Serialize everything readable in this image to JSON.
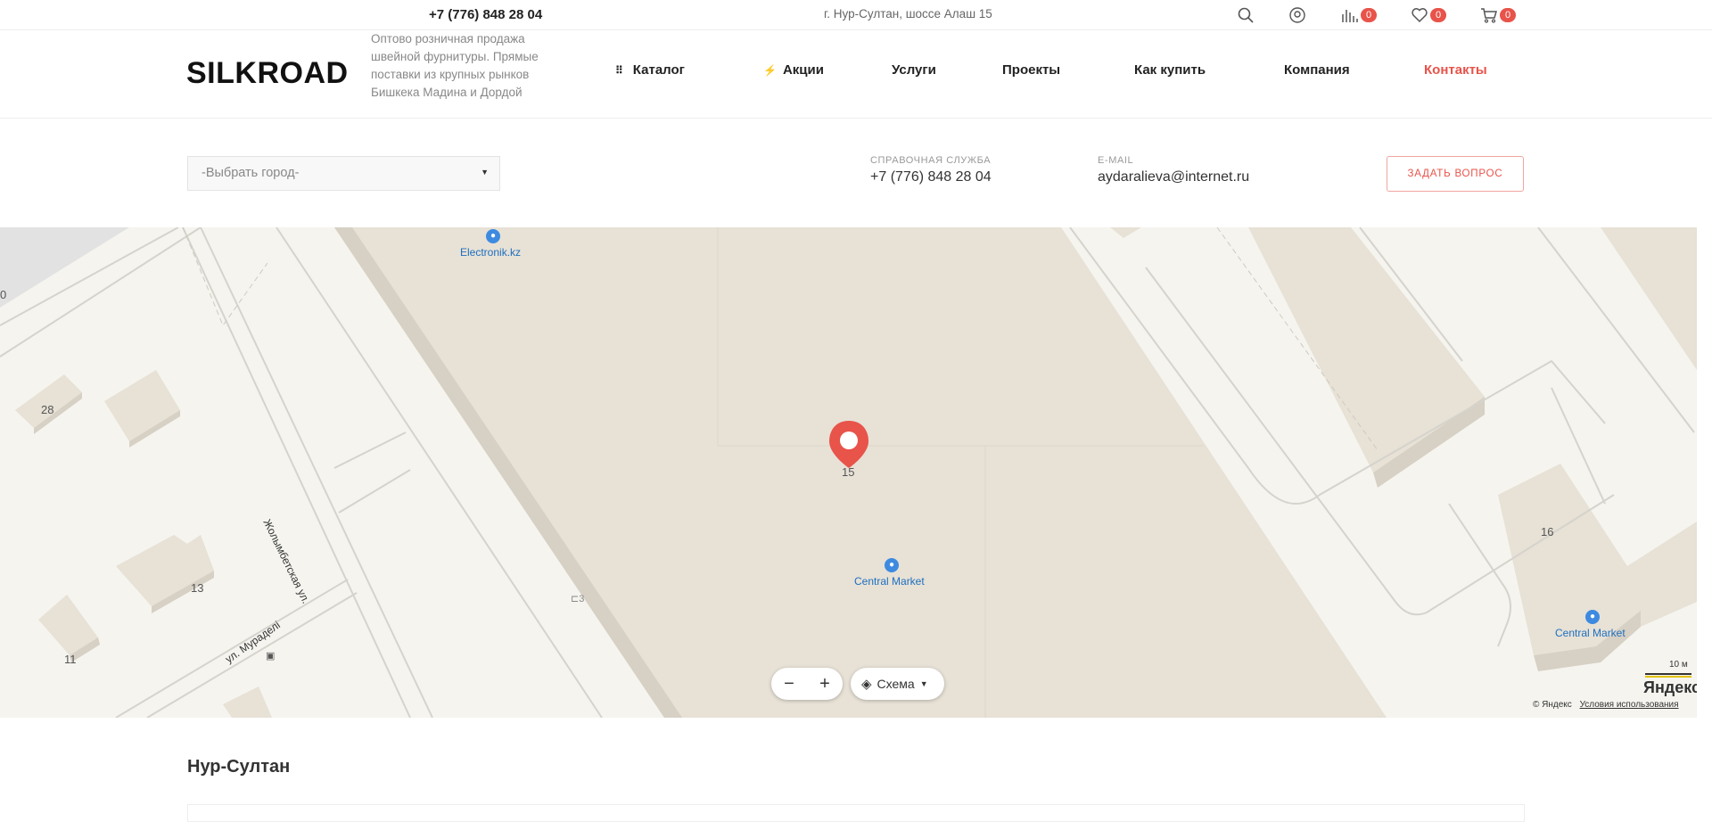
{
  "topbar": {
    "phone": "+7 (776) 848 28 04",
    "address": "г. Нур-Султан, шоссе Алаш 15",
    "icons": [
      "search-icon",
      "user-icon",
      "compare-icon",
      "heart-icon",
      "cart-icon"
    ],
    "compare_count": "0",
    "favorites_count": "0",
    "cart_count": "0"
  },
  "header": {
    "logo": "SILKROAD",
    "slogan": "Оптово розничная продажа швейной фурнитуры. Прямые поставки из крупных рынков Бишкека Мадина и Дордой"
  },
  "nav": {
    "items": [
      {
        "label": "Каталог",
        "icon": "grid-icon"
      },
      {
        "label": "Акции",
        "icon": "lightning-icon"
      },
      {
        "label": "Услуги"
      },
      {
        "label": "Проекты"
      },
      {
        "label": "Как купить"
      },
      {
        "label": "Компания"
      },
      {
        "label": "Контакты",
        "active": true
      }
    ]
  },
  "contacts": {
    "city_select": "-Выбрать город-",
    "help_label": "Справочная служба",
    "help_phone": "+7 (776) 848 28 04",
    "email_label": "E-mail",
    "email": "aydaralieva@internet.ru",
    "ask_button": "ЗАДАТЬ ВОПРОС"
  },
  "map": {
    "poi_labels": [
      "Electronik.kz",
      "Central Market",
      "Central Market"
    ],
    "house_numbers": [
      "0",
      "28",
      "13",
      "11",
      "15",
      "16",
      "3"
    ],
    "streets": [
      "Жолымбетская ул.",
      "ул. Мураделі"
    ],
    "zoom_minus": "−",
    "zoom_plus": "+",
    "layer_label": "Схема",
    "scale": "10 м",
    "logo": "Яндекс",
    "copyright": "© Яндекс",
    "terms": "Условия использования"
  },
  "footer": {
    "city_title": "Нур-Султан"
  },
  "colors": {
    "accent": "#e8534a",
    "map_block": "#e7e1d6",
    "map_bg": "#f5f4ef",
    "poi": "#3d8ae0"
  }
}
